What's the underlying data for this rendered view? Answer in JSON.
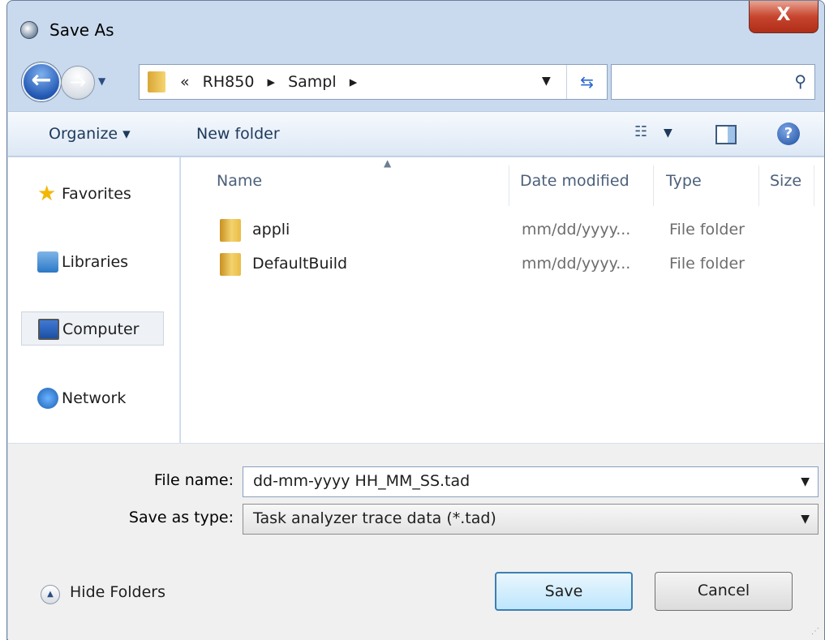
{
  "window": {
    "title": "Save As",
    "close_glyph": "X"
  },
  "nav": {
    "back_glyph": "←",
    "forward_glyph": "→",
    "address_crumbs": [
      "«",
      "RH850",
      "▸",
      "Sampl",
      "▸"
    ],
    "search_placeholder": ""
  },
  "toolbar": {
    "organize_label": "Organize ▾",
    "new_folder_label": "New folder"
  },
  "sidebar": {
    "items": [
      {
        "label": "Favorites",
        "icon": "star-icon"
      },
      {
        "label": "Libraries",
        "icon": "libraries-icon"
      },
      {
        "label": "Computer",
        "icon": "computer-icon",
        "selected": true
      },
      {
        "label": "Network",
        "icon": "network-icon"
      }
    ]
  },
  "file_list": {
    "columns": [
      "Name",
      "Date modified",
      "Type",
      "Size"
    ],
    "rows": [
      {
        "name": "appli",
        "date": "mm/dd/yyyy...",
        "type": "File folder"
      },
      {
        "name": "DefaultBuild",
        "date": "mm/dd/yyyy...",
        "type": "File folder"
      }
    ]
  },
  "form": {
    "file_name_label": "File name:",
    "file_name_value": "dd-mm-yyyy HH_MM_SS.tad",
    "save_type_label": "Save as type:",
    "save_type_value": "Task analyzer trace data (*.tad)"
  },
  "footer": {
    "hide_folders_label": "Hide Folders",
    "save_label": "Save",
    "cancel_label": "Cancel"
  }
}
